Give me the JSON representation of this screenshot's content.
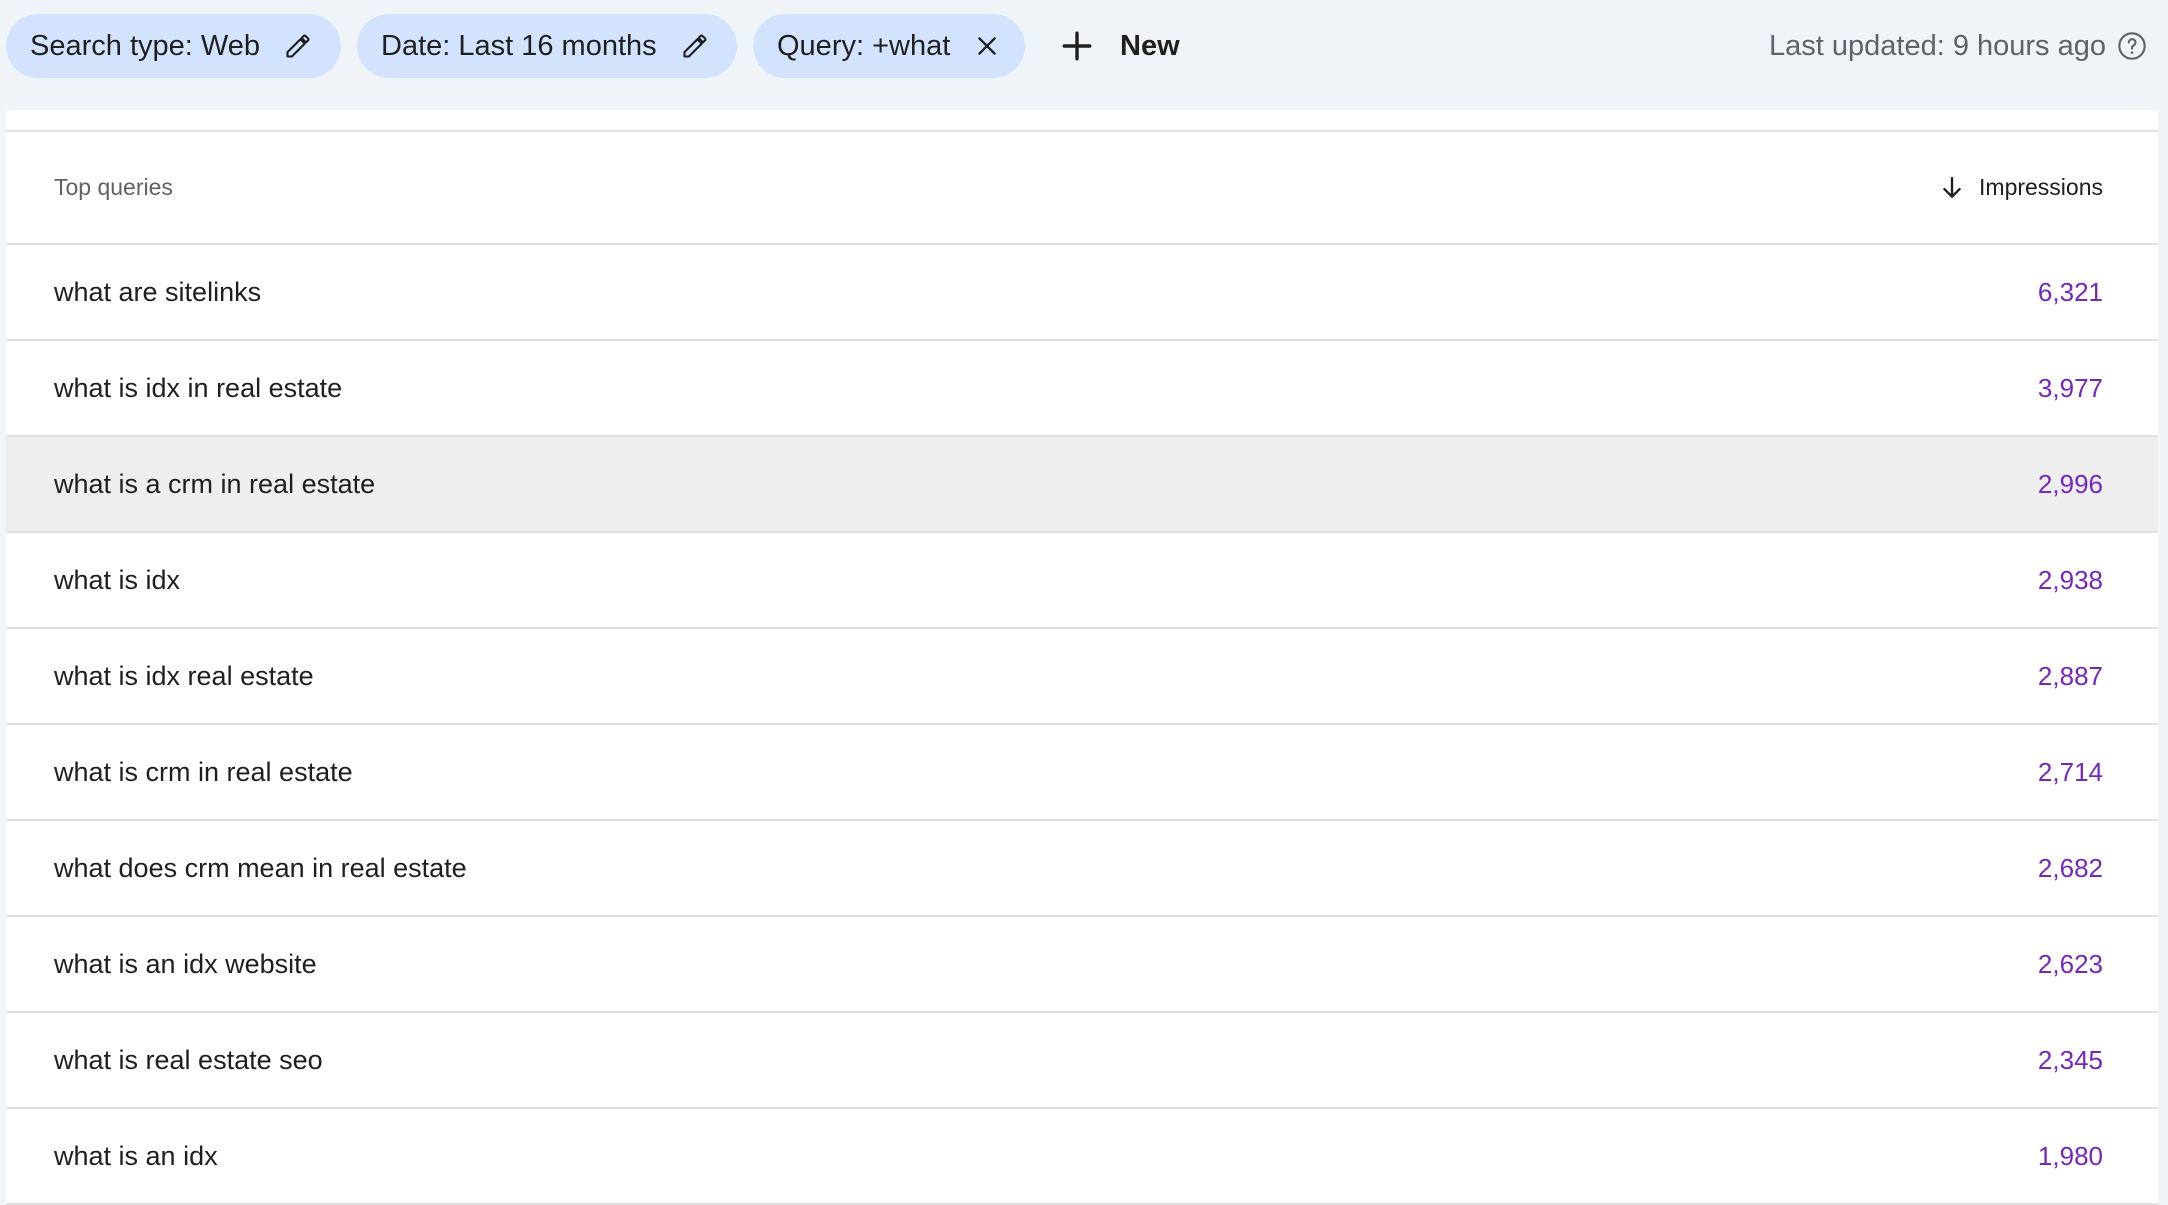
{
  "filters": {
    "search_type": "Search type: Web",
    "date": "Date: Last 16 months",
    "query": "Query: +what",
    "new_label": "New",
    "icons": {
      "edit": "pencil-icon",
      "remove": "close-icon",
      "add": "plus-icon",
      "help": "help-circle-icon"
    }
  },
  "last_updated": "Last updated: 9 hours ago",
  "table": {
    "col_query": "Top queries",
    "col_impressions": "Impressions",
    "sort_icon": "arrow-down-icon",
    "value_color": "#7627bb",
    "highlighted_row_index": 2,
    "rows": [
      {
        "query": "what are sitelinks",
        "impressions": "6,321"
      },
      {
        "query": "what is idx in real estate",
        "impressions": "3,977"
      },
      {
        "query": "what is a crm in real estate",
        "impressions": "2,996"
      },
      {
        "query": "what is idx",
        "impressions": "2,938"
      },
      {
        "query": "what is idx real estate",
        "impressions": "2,887"
      },
      {
        "query": "what is crm in real estate",
        "impressions": "2,714"
      },
      {
        "query": "what does crm mean in real estate",
        "impressions": "2,682"
      },
      {
        "query": "what is an idx website",
        "impressions": "2,623"
      },
      {
        "query": "what is real estate seo",
        "impressions": "2,345"
      },
      {
        "query": "what is an idx",
        "impressions": "1,980"
      }
    ]
  }
}
